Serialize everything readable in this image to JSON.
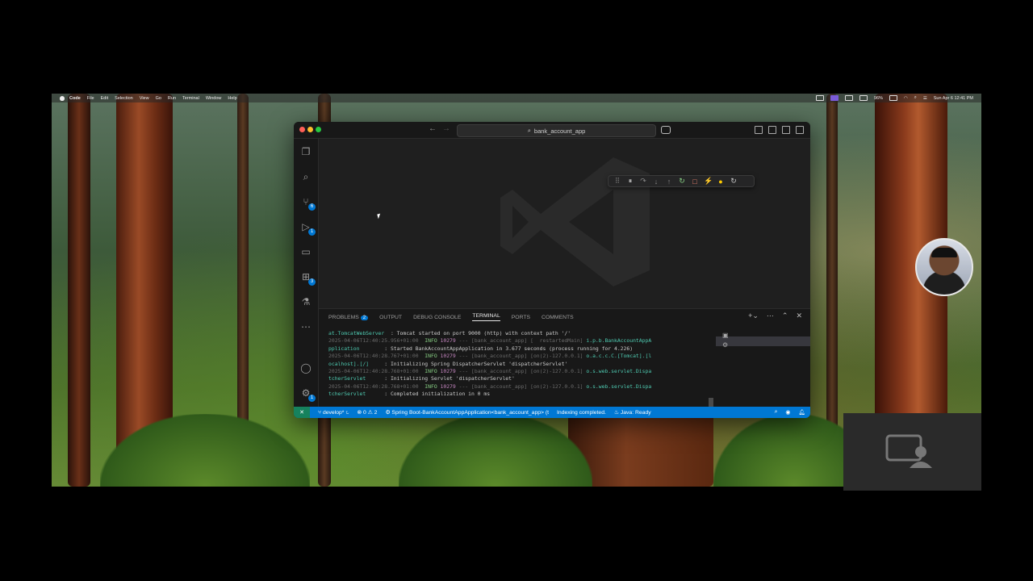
{
  "menubar": {
    "app_name": "Code",
    "items": [
      "File",
      "Edit",
      "Selection",
      "View",
      "Go",
      "Run",
      "Terminal",
      "Window",
      "Help"
    ],
    "battery": "96%",
    "clock": "Sun Apr 6  12:41 PM"
  },
  "window": {
    "search_text": "bank_account_app"
  },
  "activity_bar": {
    "scm_badge": "6",
    "run_badge": "1",
    "extensions_badge": "3",
    "settings_badge": "1"
  },
  "panel": {
    "tabs": [
      {
        "label": "PROBLEMS",
        "badge": "2"
      },
      {
        "label": "OUTPUT"
      },
      {
        "label": "DEBUG CONSOLE"
      },
      {
        "label": "TERMINAL"
      },
      {
        "label": "PORTS"
      },
      {
        "label": "COMMENTS"
      }
    ],
    "active_tab": "TERMINAL",
    "terminal_lines": [
      {
        "a": "at.TomcatWebServer",
        "b": "  : Tomcat started on port 9000 (http) with context path '/'"
      },
      {
        "ts": "2025-04-06T12:40:25.956+01:00",
        "lvl": "  INFO ",
        "pid": "10279",
        "sep": " --- [bank_account_app] [  restartedMain] ",
        "cls": "i.p.b.BankAccountAppA"
      },
      {
        "a": "pplication",
        "b": "        : Started BankAccountAppApplication in 3.677 seconds (process running for 4.226)"
      },
      {
        "ts": "2025-04-06T12:40:28.767+01:00",
        "lvl": "  INFO ",
        "pid": "10279",
        "sep": " --- [bank_account_app] [on(2)-127.0.0.1] ",
        "cls": "o.a.c.c.C.[Tomcat].[l"
      },
      {
        "a": "ocalhost].[/]",
        "b": "     : Initializing Spring DispatcherServlet 'dispatcherServlet'"
      },
      {
        "ts": "2025-04-06T12:40:28.768+01:00",
        "lvl": "  INFO ",
        "pid": "10279",
        "sep": " --- [bank_account_app] [on(2)-127.0.0.1] ",
        "cls": "o.s.web.servlet.Dispa"
      },
      {
        "a": "tcherServlet",
        "b": "      : Initializing Servlet 'dispatcherServlet'"
      },
      {
        "ts": "2025-04-06T12:40:28.768+01:00",
        "lvl": "  INFO ",
        "pid": "10279",
        "sep": " --- [bank_account_app] [on(2)-127.0.0.1] ",
        "cls": "o.s.web.servlet.Dispa"
      },
      {
        "a": "tcherServlet",
        "b": "      : Completed initialization in 0 ms"
      }
    ]
  },
  "status_bar": {
    "branch": "develop*",
    "errors": "0",
    "warnings": "2",
    "launch": "Spring Boot-BankAccountAppApplication<bank_account_app> (t",
    "indexing": "Indexing completed.",
    "java": "Java: Ready"
  },
  "colors": {
    "accent": "#0078d4",
    "editor_bg": "#1f1f1f",
    "status_bar": "#0078d4"
  }
}
